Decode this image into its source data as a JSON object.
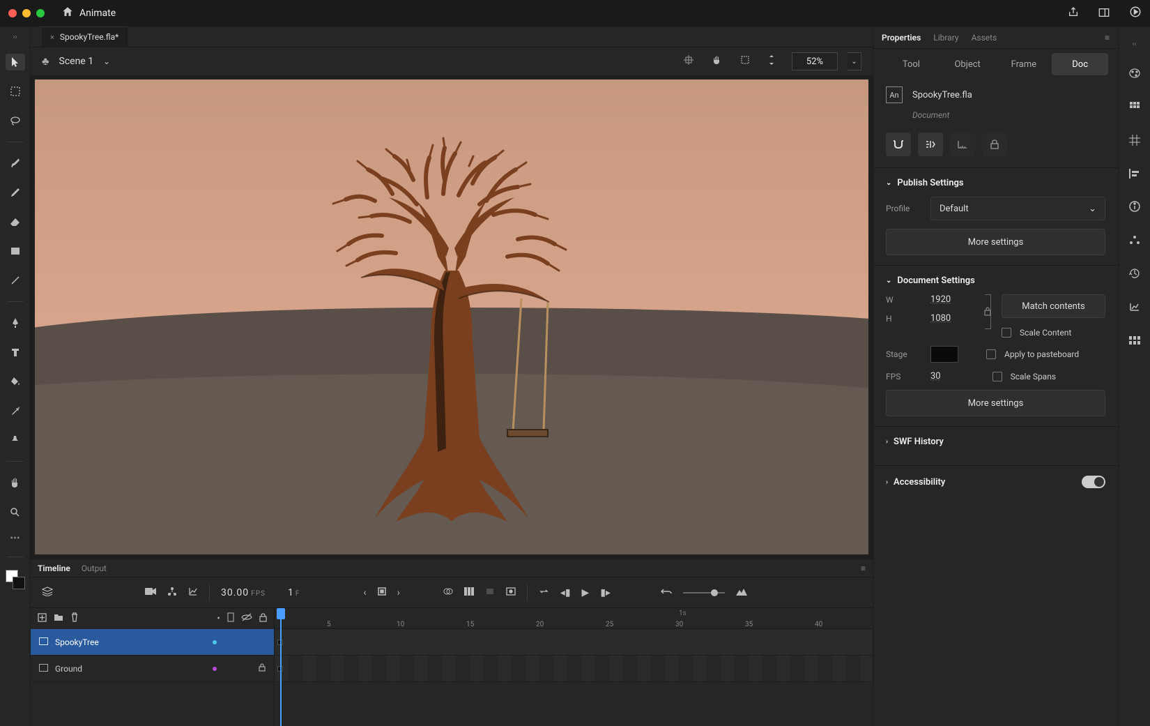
{
  "app": {
    "name": "Animate"
  },
  "document": {
    "tab": "SpookyTree.fla*",
    "scene": "Scene 1",
    "zoom": "52%"
  },
  "timeline": {
    "tabs": [
      "Timeline",
      "Output"
    ],
    "fps_display": "30.00",
    "fps_unit": "FPS",
    "frame": "1",
    "frame_unit": "F",
    "ruler_sec": "1s",
    "ticks": [
      "5",
      "10",
      "15",
      "20",
      "25",
      "30",
      "35",
      "40"
    ],
    "layers": [
      {
        "name": "SpookyTree",
        "selected": true,
        "color": "#4ac7e8",
        "locked": false
      },
      {
        "name": "Ground",
        "selected": false,
        "color": "#b84ad8",
        "locked": true
      }
    ]
  },
  "panels": {
    "tabs": [
      "Properties",
      "Library",
      "Assets"
    ],
    "subtabs": [
      "Tool",
      "Object",
      "Frame",
      "Doc"
    ],
    "doc": {
      "file": "SpookyTree.fla",
      "type": "Document",
      "publish": {
        "title": "Publish Settings",
        "profile_label": "Profile",
        "profile": "Default",
        "more": "More settings"
      },
      "settings": {
        "title": "Document Settings",
        "w_label": "W",
        "w": "1920",
        "h_label": "H",
        "h": "1080",
        "match": "Match contents",
        "stage_label": "Stage",
        "fps_label": "FPS",
        "fps": "30",
        "scale_content": "Scale Content",
        "apply_pasteboard": "Apply to pasteboard",
        "scale_spans": "Scale Spans",
        "more": "More settings"
      },
      "swf": {
        "title": "SWF History"
      },
      "access": {
        "title": "Accessibility"
      }
    }
  }
}
